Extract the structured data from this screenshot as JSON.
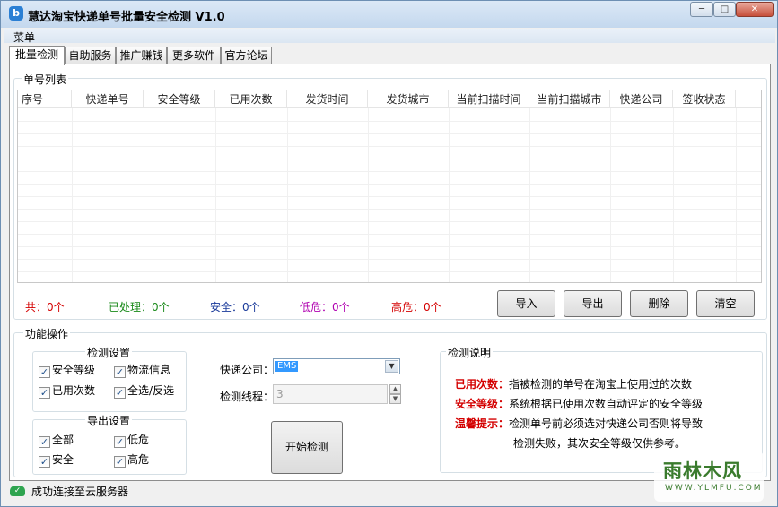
{
  "window": {
    "title": "慧达淘宝快递单号批量安全检测 V1.0",
    "icon": "app-logo-icon",
    "controls": {
      "minimize": "─",
      "maximize": "□",
      "close": "✕"
    }
  },
  "menu": {
    "label": "菜单"
  },
  "tabs": [
    {
      "label": "批量检测",
      "active": true
    },
    {
      "label": "自助服务"
    },
    {
      "label": "推广赚钱"
    },
    {
      "label": "更多软件"
    },
    {
      "label": "官方论坛"
    }
  ],
  "list_group": {
    "title": "单号列表",
    "columns": [
      "序号",
      "快递单号",
      "安全等级",
      "已用次数",
      "发货时间",
      "发货城市",
      "当前扫描时间",
      "当前扫描城市",
      "快递公司",
      "签收状态"
    ],
    "rows": []
  },
  "counts": {
    "total": {
      "text": "共：0个",
      "color": "#d40000"
    },
    "processed": {
      "text": "已处理：0个",
      "color": "#1a8a1a"
    },
    "safe": {
      "text": "安全：0个",
      "color": "#1a3a9a"
    },
    "low_risk": {
      "text": "低危：0个",
      "color": "#b000b0"
    },
    "high_risk": {
      "text": "高危：0个",
      "color": "#d40000"
    }
  },
  "buttons": {
    "import": "导入",
    "export": "导出",
    "delete": "删除",
    "clear": "清空",
    "start": "开始检测"
  },
  "operations": {
    "title": "功能操作",
    "detect_settings": {
      "title": "检测设置",
      "safety_level": "安全等级",
      "logistics_info": "物流信息",
      "used_count": "已用次数",
      "select_all": "全选/反选"
    },
    "export_settings": {
      "title": "导出设置",
      "all": "全部",
      "low_risk": "低危",
      "safe": "安全",
      "high_risk": "高危"
    },
    "courier_label": "快递公司：",
    "courier_value": "EMS",
    "threads_label": "检测线程：",
    "threads_value": "3"
  },
  "description": {
    "title": "检测说明",
    "items": [
      {
        "key": "已用次数：",
        "text": "指被检测的单号在淘宝上使用过的次数"
      },
      {
        "key": "安全等级：",
        "text": "系统根据已使用次数自动评定的安全等级"
      },
      {
        "key": "温馨提示：",
        "text": "检测单号前必须选对快递公司否则将导致"
      }
    ],
    "continuation": "检测失败，其次安全等级仅供参考。"
  },
  "status": {
    "icon": "cloud-check-icon",
    "text": "成功连接至云服务器"
  },
  "watermark": {
    "main": "雨林木风",
    "sub": "WWW.YLMFU.COM"
  }
}
